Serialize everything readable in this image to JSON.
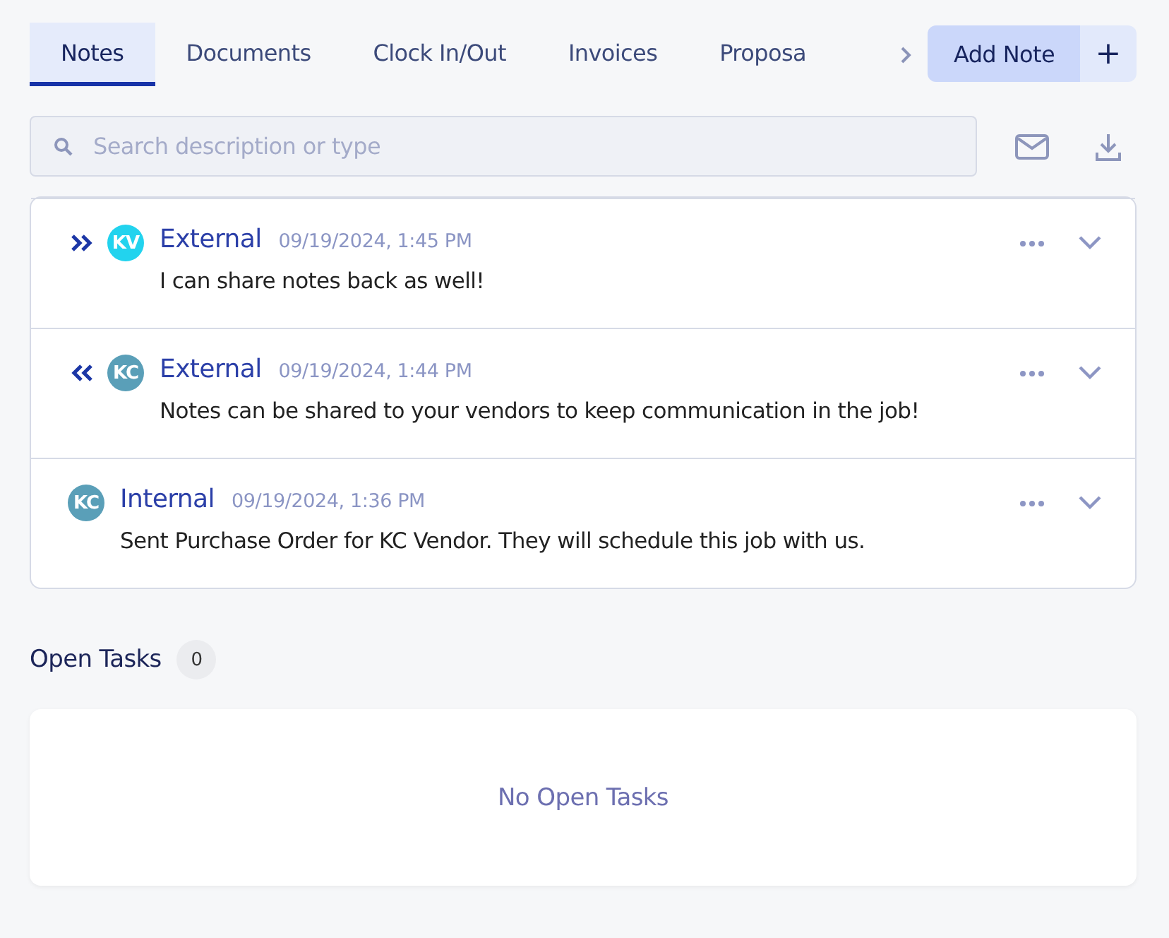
{
  "tabs": [
    {
      "label": "Notes",
      "selected": true
    },
    {
      "label": "Documents",
      "selected": false
    },
    {
      "label": "Clock In/Out",
      "selected": false
    },
    {
      "label": "Invoices",
      "selected": false
    },
    {
      "label": "Proposa",
      "selected": false
    }
  ],
  "add_button": {
    "label": "Add Note",
    "icon": "+"
  },
  "search": {
    "placeholder": "Search description or type"
  },
  "notes": [
    {
      "kind": "outgoing",
      "initials": "KV",
      "color": "#22d3ee",
      "type": "External",
      "timestamp": "09/19/2024, 1:45 PM",
      "text": "I can share notes back as well!"
    },
    {
      "kind": "incoming",
      "initials": "KC",
      "color": "#5a9fb8",
      "type": "External",
      "timestamp": "09/19/2024, 1:44 PM",
      "text": "Notes can be shared to your vendors to keep communication in the job!"
    },
    {
      "kind": "internal",
      "initials": "KC",
      "color": "#5a9fb8",
      "type": "Internal",
      "timestamp": "09/19/2024, 1:36 PM",
      "text": "Sent Purchase Order for KC Vendor. They will schedule this job with us."
    }
  ],
  "open_tasks": {
    "title": "Open Tasks",
    "count": "0",
    "empty_text": "No Open Tasks"
  }
}
